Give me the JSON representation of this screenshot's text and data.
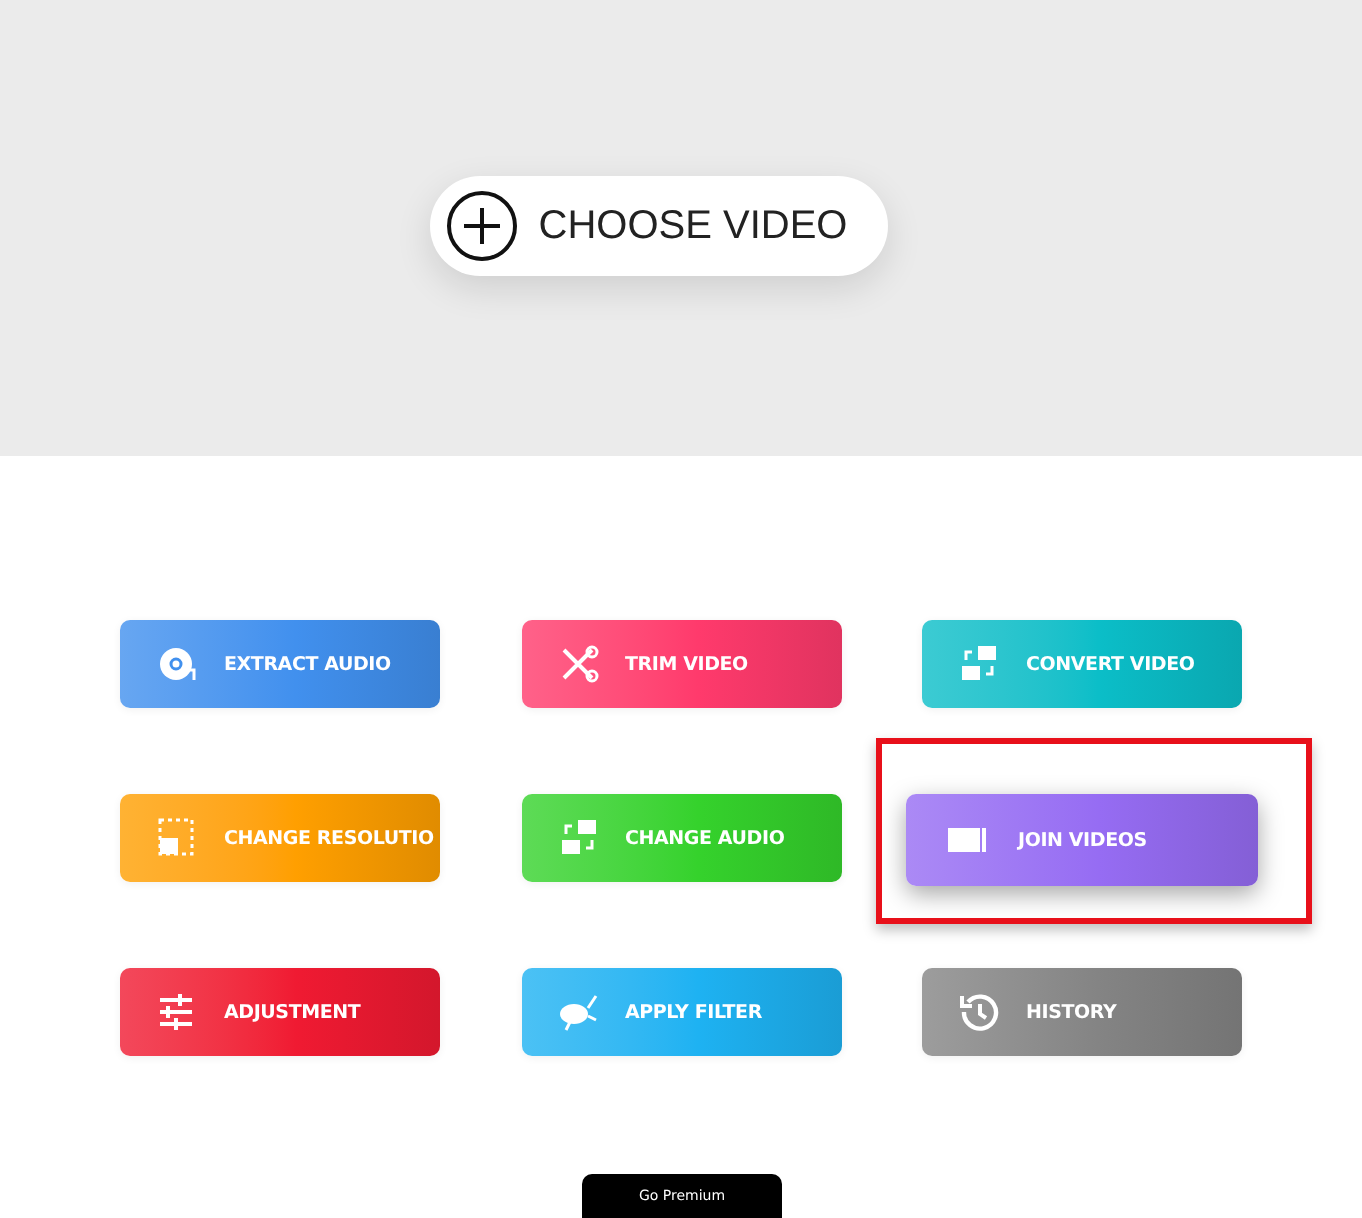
{
  "upload": {
    "label": "CHOOSE VIDEO"
  },
  "tools": [
    {
      "label": "EXTRACT AUDIO",
      "color": "#4190ee",
      "highlighted": false
    },
    {
      "label": "TRIM VIDEO",
      "color": "#ff3a6c",
      "highlighted": false
    },
    {
      "label": "CONVERT VIDEO",
      "color": "#0bbec8",
      "highlighted": false
    },
    {
      "label": "CHANGE RESOLUTIO",
      "color": "#ff9f00",
      "highlighted": false
    },
    {
      "label": "CHANGE AUDIO",
      "color": "#35d22c",
      "highlighted": false
    },
    {
      "label": "JOIN VIDEOS",
      "color": "#966cf3",
      "highlighted": true
    },
    {
      "label": "ADJUSTMENT",
      "color": "#f01a32",
      "highlighted": false
    },
    {
      "label": "APPLY FILTER",
      "color": "#1eb2f2",
      "highlighted": false
    },
    {
      "label": "HISTORY",
      "color": "#848484",
      "highlighted": false
    }
  ],
  "premium": {
    "label": "Go Premium"
  }
}
